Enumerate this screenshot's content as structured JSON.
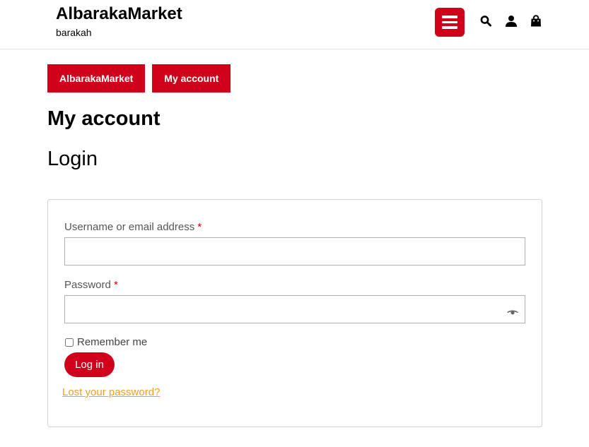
{
  "header": {
    "site_title": "AlbarakaMarket",
    "tagline": "barakah",
    "icons": [
      "menu-icon",
      "search-icon",
      "user-icon",
      "shopping-bag-icon"
    ],
    "accent_color": "#d0021b"
  },
  "breadcrumb": {
    "items": [
      {
        "label": "AlbarakaMarket"
      },
      {
        "label": "My account"
      }
    ]
  },
  "page": {
    "title": "My account",
    "login_heading": "Login"
  },
  "login_form": {
    "username_label": "Username or email address",
    "password_label": "Password",
    "required_marker": "*",
    "username_value": "",
    "password_value": "",
    "remember_label": "Remember me",
    "remember_checked": false,
    "submit_label": "Log in",
    "lost_password_label": "Lost your password?",
    "link_color": "#f0a022"
  }
}
